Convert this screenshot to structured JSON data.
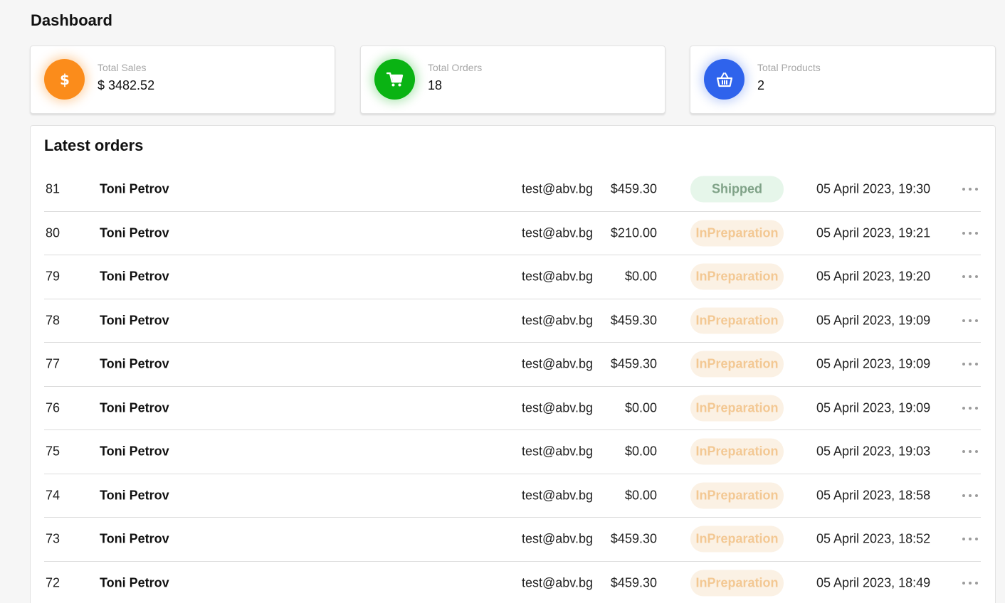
{
  "page": {
    "title": "Dashboard"
  },
  "stats": [
    {
      "label": "Total Sales",
      "value": "$ 3482.52",
      "icon": "dollar-icon",
      "color": "#fb8c1b"
    },
    {
      "label": "Total Orders",
      "value": "18",
      "icon": "cart-icon",
      "color": "#0ab313"
    },
    {
      "label": "Total Products",
      "value": "2",
      "icon": "basket-icon",
      "color": "#2f63ec"
    }
  ],
  "orders": {
    "title": "Latest orders",
    "rows": [
      {
        "id": "81",
        "name": "Toni Petrov",
        "email": "test@abv.bg",
        "amount": "$459.30",
        "status": "Shipped",
        "date": "05 April 2023, 19:30"
      },
      {
        "id": "80",
        "name": "Toni Petrov",
        "email": "test@abv.bg",
        "amount": "$210.00",
        "status": "InPreparation",
        "date": "05 April 2023, 19:21"
      },
      {
        "id": "79",
        "name": "Toni Petrov",
        "email": "test@abv.bg",
        "amount": "$0.00",
        "status": "InPreparation",
        "date": "05 April 2023, 19:20"
      },
      {
        "id": "78",
        "name": "Toni Petrov",
        "email": "test@abv.bg",
        "amount": "$459.30",
        "status": "InPreparation",
        "date": "05 April 2023, 19:09"
      },
      {
        "id": "77",
        "name": "Toni Petrov",
        "email": "test@abv.bg",
        "amount": "$459.30",
        "status": "InPreparation",
        "date": "05 April 2023, 19:09"
      },
      {
        "id": "76",
        "name": "Toni Petrov",
        "email": "test@abv.bg",
        "amount": "$0.00",
        "status": "InPreparation",
        "date": "05 April 2023, 19:09"
      },
      {
        "id": "75",
        "name": "Toni Petrov",
        "email": "test@abv.bg",
        "amount": "$0.00",
        "status": "InPreparation",
        "date": "05 April 2023, 19:03"
      },
      {
        "id": "74",
        "name": "Toni Petrov",
        "email": "test@abv.bg",
        "amount": "$0.00",
        "status": "InPreparation",
        "date": "05 April 2023, 18:58"
      },
      {
        "id": "73",
        "name": "Toni Petrov",
        "email": "test@abv.bg",
        "amount": "$459.30",
        "status": "InPreparation",
        "date": "05 April 2023, 18:52"
      },
      {
        "id": "72",
        "name": "Toni Petrov",
        "email": "test@abv.bg",
        "amount": "$459.30",
        "status": "InPreparation",
        "date": "05 April 2023, 18:49"
      }
    ]
  },
  "colors": {
    "shipped_bg": "#e6f6ea",
    "shipped_text": "#7fa287",
    "prep_bg": "#fbf1e4",
    "prep_text": "#f3c893"
  }
}
